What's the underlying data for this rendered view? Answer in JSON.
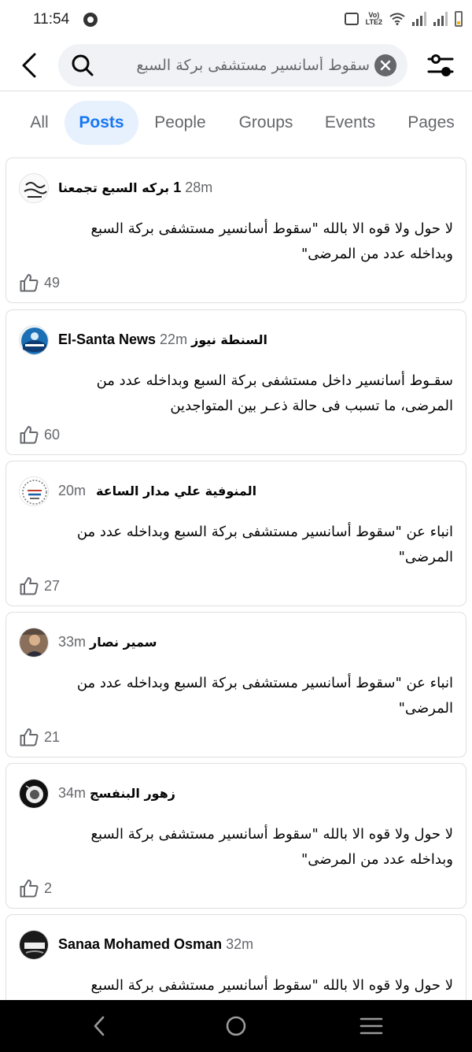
{
  "status_bar": {
    "time": "11:54",
    "network": "LTE2"
  },
  "search": {
    "query": "سقوط أسانسير مستشفى بركة السبع"
  },
  "tabs": [
    {
      "label": "All"
    },
    {
      "label": "Posts"
    },
    {
      "label": "People"
    },
    {
      "label": "Groups"
    },
    {
      "label": "Events"
    },
    {
      "label": "Pages"
    }
  ],
  "active_tab": "Posts",
  "posts": [
    {
      "author_ar": "بركه السبع تجمعنا",
      "author_suffix": "1",
      "time": "28m",
      "text_line1": "لا حول ولا قوه الا بالله \"سقوط أسانسير مستشفى بركة السبع",
      "text_line2": "وبداخله عدد من المرضى\"",
      "likes": "49"
    },
    {
      "author": "El-Santa News",
      "time": "22m",
      "author_ar": "السنطة نيوز",
      "text_line1": "سقـوط أسانسير داخل مستشفى بركة السبع وبداخله عدد من",
      "text_line2": "المرضى، ما تسبب فى حالة ذعـر بين المتواجدين",
      "likes": "60"
    },
    {
      "time": "20m",
      "author_ar": "المنوفية علي مدار الساعة",
      "text_line1": "انباء عن \"سقوط أسانسير مستشفى بركة السبع وبداخله عدد من",
      "text_line2": "المرضى\"",
      "likes": "27"
    },
    {
      "time": "33m",
      "author_ar": "سمير نصار",
      "text_line1": "انباء عن \"سقوط أسانسير مستشفى بركة السبع وبداخله عدد من",
      "text_line2": "المرضى\"",
      "likes": "21"
    },
    {
      "time": "34m",
      "author_ar": "زهور البنفسج",
      "text_line1": "لا حول ولا قوه الا بالله \"سقوط أسانسير مستشفى بركة السبع",
      "text_line2": "وبداخله عدد من المرضى\"",
      "likes": "2"
    },
    {
      "author": "Sanaa Mohamed Osman",
      "time": "32m",
      "text_line1": "لا حول ولا قوه الا بالله \"سقوط أسانسير مستشفى بركة السبع"
    }
  ],
  "colors": {
    "accent": "#1877f2",
    "accent_bg": "#e7f0fd",
    "secondary_text": "#65676b",
    "divider": "#dcdfe3",
    "search_bg": "#f0f2f5"
  },
  "icons": [
    "back-arrow-icon",
    "search-icon",
    "clear-icon",
    "filter-sliders-icon",
    "like-icon",
    "nav-back-icon",
    "nav-home-icon",
    "nav-recents-icon"
  ]
}
